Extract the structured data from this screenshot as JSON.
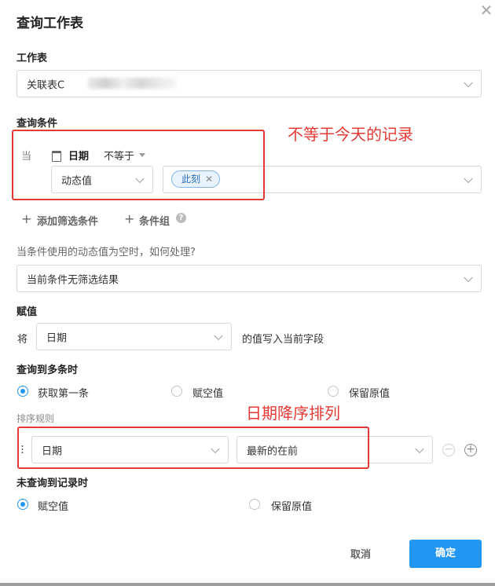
{
  "dialog": {
    "title": "查询工作表",
    "close_icon": "close-icon"
  },
  "worksheet": {
    "label": "工作表",
    "value": "关联表C"
  },
  "conditions": {
    "label": "查询条件",
    "when": "当",
    "field_icon": "calendar-icon",
    "field": "日期",
    "operator": "不等于",
    "value_type": "动态值",
    "value_tag": "此刻",
    "add_filter": "添加筛选条件",
    "add_group": "条件组"
  },
  "empty_handling": {
    "question": "当条件使用的动态值为空时，如何处理?",
    "value": "当前条件无筛选结果"
  },
  "assign": {
    "label": "赋值",
    "prefix": "将",
    "field": "日期",
    "suffix": "的值写入当前字段"
  },
  "multiple": {
    "label": "查询到多条时",
    "options": [
      "获取第一条",
      "赋空值",
      "保留原值"
    ],
    "selected": 0
  },
  "sort": {
    "label": "排序规则",
    "field": "日期",
    "order": "最新的在前"
  },
  "none_found": {
    "label": "未查询到记录时",
    "options": [
      "赋空值",
      "保留原值"
    ],
    "selected": 0
  },
  "annotations": {
    "conditions_note": "不等于今天的记录",
    "sort_note": "日期降序排列"
  },
  "footer": {
    "cancel": "取消",
    "confirm": "确定"
  },
  "colors": {
    "primary": "#2196f3",
    "annotation": "#e53935",
    "tag_border": "#7cb5ea"
  }
}
